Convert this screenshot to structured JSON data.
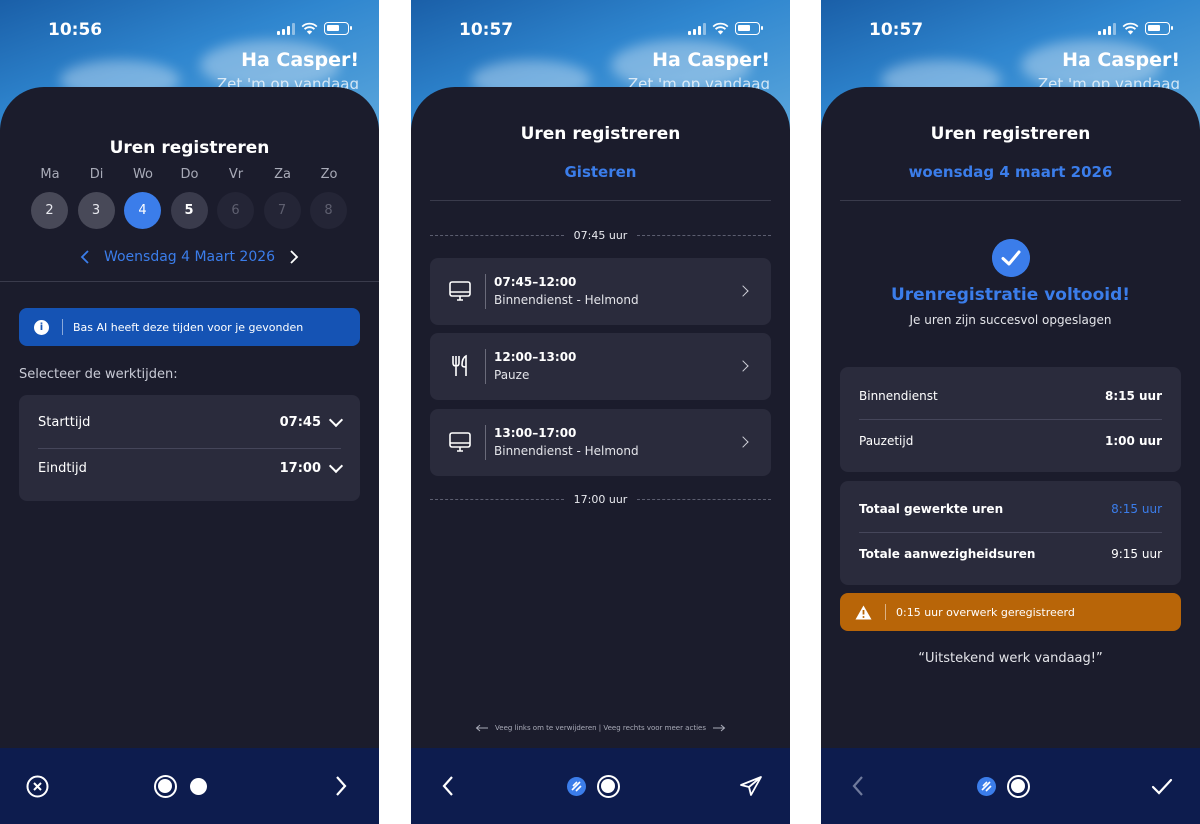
{
  "common": {
    "greeting": "Ha Casper!",
    "greeting_sub": "Zet 'm op vandaag",
    "title": "Uren registreren"
  },
  "screen1": {
    "time": "10:56",
    "weekdays": [
      {
        "label": "Ma",
        "num": "2",
        "state": "past"
      },
      {
        "label": "Di",
        "num": "3",
        "state": "past"
      },
      {
        "label": "Wo",
        "num": "4",
        "state": "selected"
      },
      {
        "label": "Do",
        "num": "5",
        "state": "today"
      },
      {
        "label": "Vr",
        "num": "6",
        "state": "future"
      },
      {
        "label": "Za",
        "num": "7",
        "state": "future"
      },
      {
        "label": "Zo",
        "num": "8",
        "state": "future"
      }
    ],
    "date_label": "Woensdag 4 Maart 2026",
    "ai_banner": "Bas AI heeft deze tijden voor je gevonden",
    "select_label": "Selecteer de werktijden:",
    "fields": [
      {
        "label": "Starttijd",
        "value": "07:45"
      },
      {
        "label": "Eindtijd",
        "value": "17:00"
      }
    ]
  },
  "screen2": {
    "time": "10:57",
    "subtitle": "Gisteren",
    "start_marker": "07:45 uur",
    "end_marker": "17:00 uur",
    "entries": [
      {
        "time": "07:45–12:00",
        "desc": "Binnendienst - Helmond",
        "icon": "monitor-icon"
      },
      {
        "time": "12:00–13:00",
        "desc": "Pauze",
        "icon": "cutlery-icon"
      },
      {
        "time": "13:00–17:00",
        "desc": "Binnendienst - Helmond",
        "icon": "monitor-icon"
      }
    ],
    "hint": "Veeg links om te verwijderen | Veeg rechts voor meer acties"
  },
  "screen3": {
    "time": "10:57",
    "subtitle": "woensdag 4 maart 2026",
    "success_title": "Urenregistratie voltooid!",
    "success_sub": "Je uren zijn succesvol opgeslagen",
    "breakdown": [
      {
        "label": "Binnendienst",
        "value": "8:15 uur"
      },
      {
        "label": "Pauzetijd",
        "value": "1:00 uur"
      }
    ],
    "totals": [
      {
        "label": "Totaal gewerkte uren",
        "value": "8:15 uur"
      },
      {
        "label": "Totale aanwezigheidsuren",
        "value": "9:15 uur"
      }
    ],
    "warning": "0:15 uur overwerk geregistreerd",
    "quote": "“Uitstekend werk vandaag!”"
  },
  "colors": {
    "accent": "#3b7dea",
    "background": "#1b1c2c",
    "card": "#2a2b3c",
    "bottom_bar": "#0d1c4e",
    "ai_banner": "#1553b4",
    "warning": "#b86508"
  }
}
